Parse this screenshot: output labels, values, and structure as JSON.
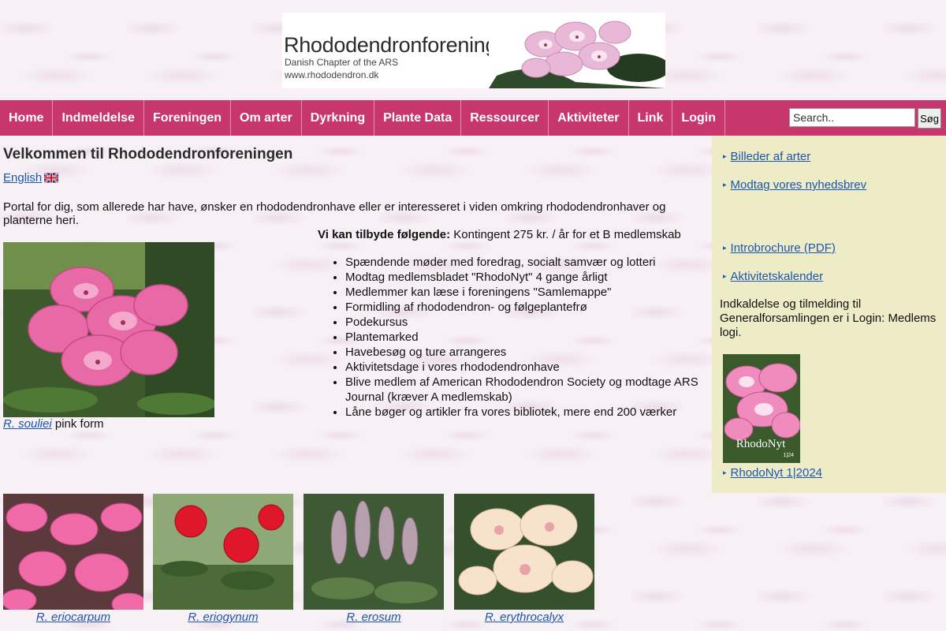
{
  "header": {
    "title": "Rhododendronforeningen",
    "subtitle": "Danish Chapter of the ARS",
    "url": "www.rhododendron.dk"
  },
  "nav": {
    "items": [
      "Home",
      "Indmeldelse",
      "Foreningen",
      "Om arter",
      "Dyrkning",
      "Plante Data",
      "Ressourcer",
      "Aktiviteter",
      "Link",
      "Login"
    ]
  },
  "search": {
    "placeholder": "Search..",
    "value": "Search..",
    "button_label": "Søg"
  },
  "main": {
    "title": "Velkommen til Rhododendronforeningen",
    "english_label": "English",
    "intro": "Portal for dig, som allerede har have, ønsker en rhododendronhave eller er interesseret i viden omkring rhododendronhaver og planterne heri.",
    "image_caption_link": "R. souliei",
    "image_caption_text": " pink form",
    "offer_head_bold": "Vi kan tilbyde følgende:",
    "offer_head_text": " Kontingent 275 kr. / år for et B medlemskab",
    "offers": [
      "Spændende møder med foredrag, socialt samvær og lotteri",
      "Modtag medlemsbladet \"RhodoNyt\" 4 gange årligt",
      "Medlemmer kan læse i foreningens \"Samlemappe\"",
      "Formidling af rhododendron- og følgeplantefrø",
      "Podekursus",
      "Plantemarked",
      "Havebesøg og ture arrangeres",
      "Aktivitetsdage i vores rhododendronhave",
      "Blive medlem af American Rhododendron Society og modtage ARS Journal (kræver A medlemskab)",
      "Låne bøger og artikler fra vores bibliotek, mere end 200 værker"
    ],
    "gallery": [
      "R. eriocarpum",
      "R. eriogynum",
      "R. erosum",
      "R. erythrocalyx"
    ]
  },
  "sidebar": {
    "links": [
      "Billeder af arter",
      "Modtag vores nyhedsbrev",
      "Introbrochure (PDF)",
      "Aktivitetskalender"
    ],
    "notice": "Indkaldelse og tilmelding til Generalforsamlingen er i Login: Medlems logi.",
    "magazine_title": "RhodoNyt",
    "magazine_issue": "1|24",
    "magazine_link": "RhodoNyt 1|2024"
  },
  "colors": {
    "nav": "#c8366e",
    "sidebar": "#eeecc6",
    "link": "#1a55b0"
  }
}
